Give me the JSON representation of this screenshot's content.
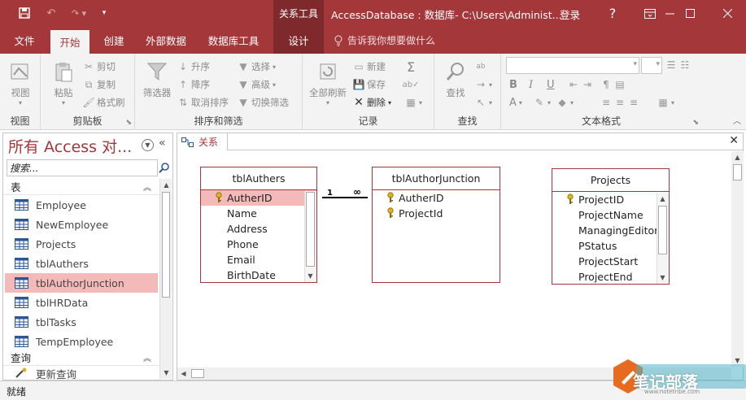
{
  "titlebar": {
    "context_tab": "关系工具",
    "window_title": "AccessDatabase : 数据库- C:\\Users\\Administ...",
    "signin": "登录",
    "help": "?",
    "save_icon": "save-icon",
    "undo_icon": "undo-icon",
    "redo_icon": "redo-icon"
  },
  "tabs": [
    {
      "label": "文件"
    },
    {
      "label": "开始"
    },
    {
      "label": "创建"
    },
    {
      "label": "外部数据"
    },
    {
      "label": "数据库工具"
    },
    {
      "label": "设计"
    }
  ],
  "tellme": "告诉我你想要做什么",
  "ribbon": {
    "views": {
      "label": "视图",
      "view": "视图"
    },
    "clipboard": {
      "label": "剪贴板",
      "paste": "粘贴",
      "cut": "剪切",
      "copy": "复制",
      "format_painter": "格式刷"
    },
    "sort_filter": {
      "label": "排序和筛选",
      "filter": "筛选器",
      "ascending": "升序",
      "descending": "降序",
      "clear_sort": "取消排序",
      "selection": "选择",
      "advanced": "高级",
      "toggle_filter": "切换筛选"
    },
    "records": {
      "label": "记录",
      "refresh_all": "全部刷新",
      "new": "新建",
      "save": "保存",
      "delete": "删除"
    },
    "find": {
      "label": "查找",
      "find": "查找"
    },
    "text_format": {
      "label": "文本格式",
      "bold": "B",
      "italic": "I",
      "underline": "U",
      "font_color": "A"
    }
  },
  "nav": {
    "title": "所有 Access 对...",
    "search_placeholder": "搜索...",
    "sections": [
      {
        "label": "表"
      },
      {
        "label": "查询"
      }
    ],
    "tables": [
      {
        "label": "Employee"
      },
      {
        "label": "NewEmployee"
      },
      {
        "label": "Projects"
      },
      {
        "label": "tblAuthers"
      },
      {
        "label": "tblAuthorJunction"
      },
      {
        "label": "tblHRData"
      },
      {
        "label": "tblTasks"
      },
      {
        "label": "TempEmployee"
      }
    ],
    "queries": [
      {
        "label": "更新查询"
      }
    ],
    "selected_index": 4
  },
  "doc": {
    "tab_label": "关系",
    "close": "✕",
    "tables": [
      {
        "title": "tblAuthers",
        "fields": [
          "AutherID",
          "Name",
          "Address",
          "Phone",
          "Email",
          "BirthDate"
        ],
        "key_fields": [
          0
        ],
        "selected_field": 0
      },
      {
        "title": "tblAuthorJunction",
        "fields": [
          "AutherID",
          "ProjectId"
        ],
        "key_fields": [
          0,
          1
        ]
      },
      {
        "title": "Projects",
        "fields": [
          "ProjectID",
          "ProjectName",
          "ManagingEditor",
          "PStatus",
          "ProjectStart",
          "ProjectEnd"
        ],
        "key_fields": [
          0
        ]
      }
    ],
    "relationship": {
      "one_label": "1",
      "many_label": "∞"
    }
  },
  "status": {
    "text": "就绪"
  },
  "watermark": {
    "text": "笔记部落",
    "url": "www.notetribe.com"
  },
  "colors": {
    "brand": "#a4373a",
    "brand_dark": "#7e2a2d",
    "selection": "#f4b9b9"
  }
}
